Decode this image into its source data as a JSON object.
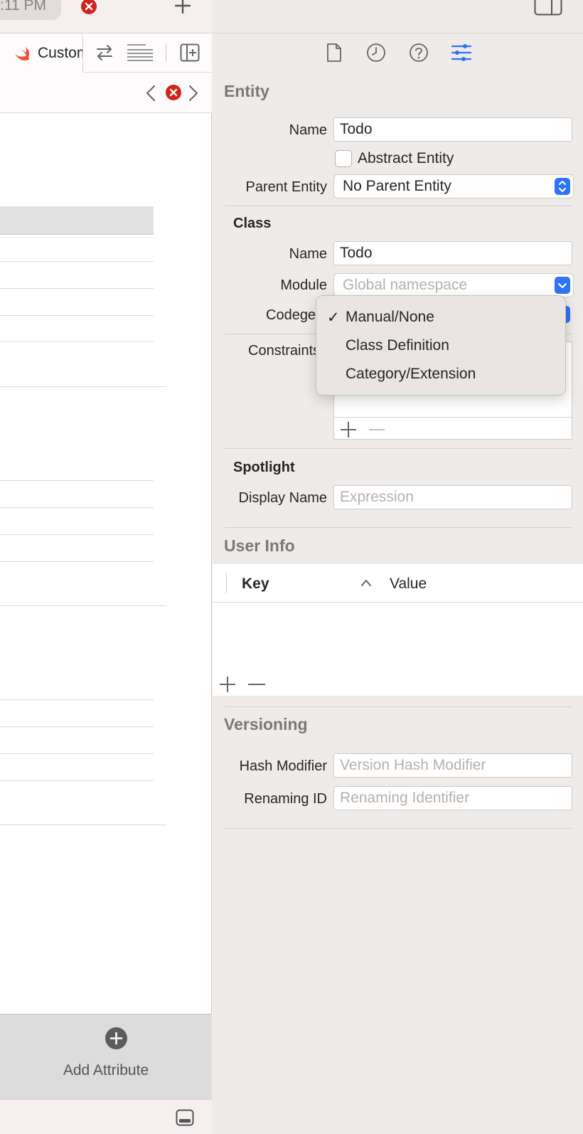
{
  "tabbar": {
    "time_text": ":11 PM"
  },
  "toolbar": {
    "file_tab_label": "Custom"
  },
  "left": {
    "add_attribute_label": "Add Attribute"
  },
  "inspector": {
    "entity": {
      "title": "Entity",
      "name_label": "Name",
      "name_value": "Todo",
      "abstract_label": "Abstract Entity",
      "abstract_checked": false,
      "parent_label": "Parent Entity",
      "parent_value": "No Parent Entity"
    },
    "class": {
      "title": "Class",
      "name_label": "Name",
      "name_value": "Todo",
      "module_label": "Module",
      "module_placeholder": "Global namespace",
      "codegen_label": "Codegen",
      "constraints_label": "Constraints"
    },
    "spotlight": {
      "title": "Spotlight",
      "display_name_label": "Display Name",
      "display_name_placeholder": "Expression"
    },
    "user_info": {
      "title": "User Info",
      "col_key": "Key",
      "col_value": "Value"
    },
    "versioning": {
      "title": "Versioning",
      "hash_label": "Hash Modifier",
      "hash_placeholder": "Version Hash Modifier",
      "renaming_label": "Renaming ID",
      "renaming_placeholder": "Renaming Identifier"
    }
  },
  "codegen_menu": {
    "items": [
      "Manual/None",
      "Class Definition",
      "Category/Extension"
    ],
    "selected": "Manual/None",
    "check_glyph": "✓"
  },
  "colors": {
    "accent": "#2f74f6",
    "error": "#d0241b",
    "swift": "#f05138"
  }
}
